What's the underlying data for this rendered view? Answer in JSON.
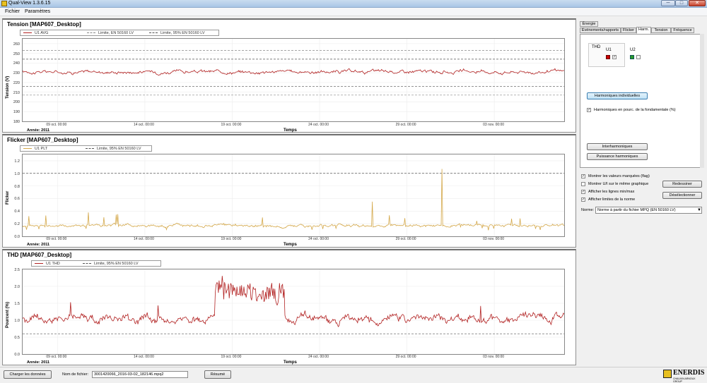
{
  "window": {
    "title": "Qual-View 1.3.6.15",
    "minimize": "─",
    "maximize": "□",
    "close": "✕"
  },
  "menu": [
    "Fichier",
    "Paramètres"
  ],
  "colors": {
    "u1_series": "#b22222",
    "flicker_series": "#d4a84a",
    "limit_line": "#888888",
    "limit95_line": "#555555",
    "active_tab_bg": "#ffffff"
  },
  "x_ticks": [
    "09 oct. 00:00",
    "14 oct. 00:00",
    "19 oct. 00:00",
    "24 oct. 00:00",
    "29 oct. 00:00",
    "03 nov. 00:00"
  ],
  "year_label": "Année: 2011",
  "x_axis_label": "Temps",
  "panels": [
    {
      "title": "Tension  [MAP607_Desktop]",
      "legend": [
        "U1 AVG",
        "Limite, EN 50160 LV",
        "Limite, 95% EN 50160 LV"
      ],
      "ylabel": "Tension (V)",
      "yticks": [
        "260",
        "250",
        "240",
        "230",
        "220",
        "210",
        "200",
        "190",
        "180"
      ]
    },
    {
      "title": "Flicker  [MAP607_Desktop]",
      "legend": [
        "U1 PLT",
        "Limite, 95% EN 50160 LV"
      ],
      "ylabel": "Flicker",
      "yticks": [
        "1.2",
        "1.0",
        "0.8",
        "0.6",
        "0.4",
        "0.2",
        "0.0"
      ]
    },
    {
      "title": "THD  [MAP607_Desktop]",
      "legend": [
        "U1 THD",
        "Limite, 95% EN 50160 LV"
      ],
      "ylabel": "Pourcent (%)",
      "yticks": [
        "2.5",
        "2.0",
        "1.5",
        "1.0",
        "0.5",
        "0.0"
      ]
    }
  ],
  "chart_data": [
    {
      "type": "line",
      "title": "Tension  [MAP607_Desktop]",
      "xlabel": "Temps",
      "ylabel": "Tension (V)",
      "ylim": [
        180,
        265
      ],
      "x_range": [
        "2011-10-07",
        "2011-11-07"
      ],
      "series": [
        {
          "name": "U1 AVG",
          "level": 231,
          "noise": 1.6
        },
        {
          "name": "Limite, EN 50160 LV",
          "values": [
            253,
            207
          ]
        },
        {
          "name": "Limite, 95% EN 50160 LV",
          "values": [
            244,
            216
          ]
        }
      ]
    },
    {
      "type": "line",
      "title": "Flicker  [MAP607_Desktop]",
      "xlabel": "Temps",
      "ylabel": "Flicker",
      "ylim": [
        0,
        1.3
      ],
      "x_range": [
        "2011-10-07",
        "2011-11-07"
      ],
      "series": [
        {
          "name": "U1 PLT",
          "level": 0.17,
          "noise": 0.02,
          "peaks": [
            {
              "x": "2011-10-27",
              "y": 0.55
            },
            {
              "x": "2011-10-31",
              "y": 1.07
            },
            {
              "x": "2011-11-04",
              "y": 0.28
            }
          ]
        },
        {
          "name": "Limite, 95% EN 50160 LV",
          "values": [
            1.0
          ]
        }
      ]
    },
    {
      "type": "line",
      "title": "THD  [MAP607_Desktop]",
      "xlabel": "Temps",
      "ylabel": "Pourcent (%)",
      "ylim": [
        0,
        2.5
      ],
      "x_range": [
        "2011-10-07",
        "2011-11-07"
      ],
      "series": [
        {
          "name": "U1 THD",
          "level": 1.05,
          "noise": 0.12,
          "high_period": {
            "start": "2011-10-18",
            "end": "2011-10-22",
            "level": 1.8
          }
        },
        {
          "name": "Limite, 95% EN 50160 LV",
          "values": [
            0.6
          ]
        }
      ]
    }
  ],
  "right_panel": {
    "tabs_row1": [
      "Énergie"
    ],
    "tabs_row2": [
      "Événements/rapports",
      "Flicker",
      "Harm.",
      "Tension",
      "Fréquence"
    ],
    "active_tab": "Harm.",
    "thd_label": "THD",
    "u1_label": "U1",
    "u2_label": "U2",
    "btn_harmoniques": "Harmoniques individuelles",
    "cb_pourc": "Harmoniques en pourc. de la fondamentale (%)",
    "btn_inter": "Interharmoniques",
    "btn_puissance": "Puissance harmoniques",
    "options": [
      {
        "label": "Montrer les valeurs marquées (flag)",
        "checked": true
      },
      {
        "label": "Montrer U/I sur le même graphique",
        "checked": false
      },
      {
        "label": "Afficher les lignes min/max",
        "checked": true
      },
      {
        "label": "Afficher limites de la norme",
        "checked": true
      }
    ],
    "btn_redessiner": "Redessiner",
    "btn_deselectionner": "Désélectionner",
    "norme_label": "Norme:",
    "norme_value": "Norme à partir du fichier MPQ (EN 50160 LV)"
  },
  "bottom": {
    "load_btn": "Charger les données",
    "file_label": "Nom de fichier:",
    "file_value": "3001420066_2016-03-02_182146.mpq2",
    "resume_btn": "Résumé"
  },
  "logo": {
    "text": "ENERDIS",
    "sub": "CHAUVIN ARNOUX GROUP"
  }
}
